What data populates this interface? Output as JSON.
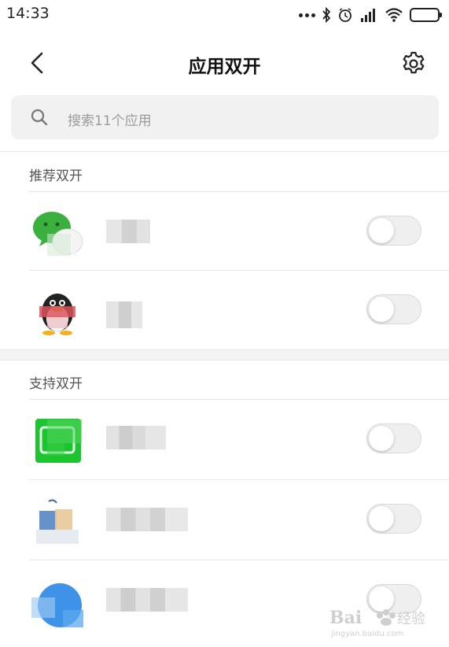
{
  "status_bar": {
    "time": "14:33"
  },
  "header": {
    "title": "应用双开"
  },
  "search": {
    "placeholder": "搜索11个应用"
  },
  "sections": {
    "recommended": {
      "title": "推荐双开"
    },
    "supported": {
      "title": "支持双开"
    }
  },
  "apps": [
    {
      "name": "",
      "icon": "wechat-icon",
      "enabled": false
    },
    {
      "name": "",
      "icon": "qq-icon",
      "enabled": false
    },
    {
      "name": "",
      "icon": "iqiyi-icon",
      "enabled": false
    },
    {
      "name": "",
      "icon": "mouse-app-icon",
      "enabled": false
    },
    {
      "name": "",
      "icon": "blue-circle-app-icon",
      "enabled": false
    }
  ],
  "colors": {
    "accent": "#1aad19",
    "toggle_off": "#efefef",
    "search_bg": "#f1f1f1"
  }
}
